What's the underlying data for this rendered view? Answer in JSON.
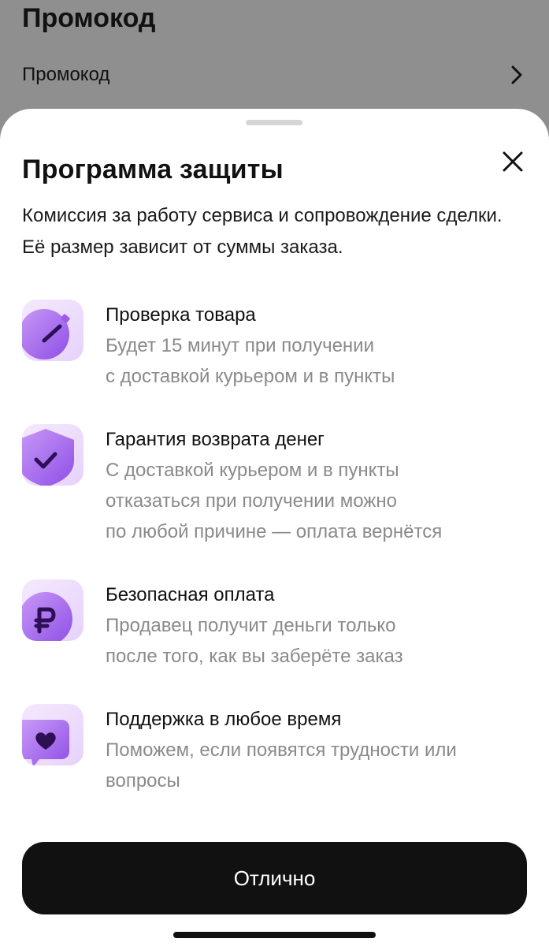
{
  "background": {
    "title": "Промокод",
    "row_label": "Промокод"
  },
  "sheet": {
    "title": "Программа защиты",
    "description": "Комиссия за работу сервиса и сопровождение сделки. Её размер зависит от суммы заказа.",
    "features": [
      {
        "icon": "stopwatch-icon",
        "title": "Проверка товара",
        "description": "Будет 15 минут при получении\nс доставкой курьером и в пункты"
      },
      {
        "icon": "shield-check-icon",
        "title": "Гарантия возврата денег",
        "description": "С доставкой курьером и в пункты\nотказаться при получении можно\nпо любой причине — оплата вернётся"
      },
      {
        "icon": "ruble-coin-icon",
        "title": "Безопасная оплата",
        "description": "Продавец получит деньги только\nпосле того, как вы заберёте заказ"
      },
      {
        "icon": "heart-chat-icon",
        "title": "Поддержка в любое время",
        "description": "Поможем, если появятся трудности или\nвопросы"
      }
    ],
    "ok_button": "Отлично"
  },
  "colors": {
    "accent": "#8e4ee6",
    "icon_bg": "#efe0fc",
    "button_bg": "#111111"
  }
}
